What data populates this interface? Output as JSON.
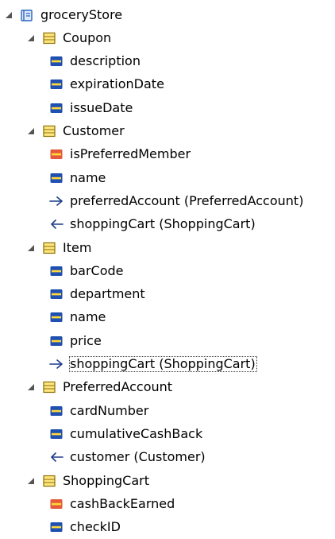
{
  "colors": {
    "attribute_fill": "#1f4fb0",
    "attribute_highlight": "#ffd83a",
    "boolean_fill": "#e45a3a",
    "entity_fill": "#ffe680",
    "entity_border": "#8a6d00",
    "model_icon": "#2b65c4",
    "relationship_stroke": "#1d3d8a"
  },
  "tree": [
    {
      "label": "groceryStore",
      "icon": "model-icon",
      "depth": 0,
      "expanded": true
    },
    {
      "label": "Coupon",
      "icon": "entity-icon",
      "depth": 1,
      "expanded": true
    },
    {
      "label": "description",
      "icon": "attribute-icon",
      "depth": 2
    },
    {
      "label": "expirationDate",
      "icon": "attribute-icon",
      "depth": 2
    },
    {
      "label": "issueDate",
      "icon": "attribute-icon",
      "depth": 2
    },
    {
      "label": "Customer",
      "icon": "entity-icon",
      "depth": 1,
      "expanded": true
    },
    {
      "label": "isPreferredMember",
      "icon": "boolean-attribute-icon",
      "depth": 2
    },
    {
      "label": "name",
      "icon": "attribute-icon",
      "depth": 2
    },
    {
      "label": "preferredAccount (PreferredAccount)",
      "icon": "to-one-relationship-icon",
      "depth": 2
    },
    {
      "label": "shoppingCart (ShoppingCart)",
      "icon": "to-many-relationship-icon",
      "depth": 2
    },
    {
      "label": "Item",
      "icon": "entity-icon",
      "depth": 1,
      "expanded": true
    },
    {
      "label": "barCode",
      "icon": "attribute-icon",
      "depth": 2
    },
    {
      "label": "department",
      "icon": "attribute-icon",
      "depth": 2
    },
    {
      "label": "name",
      "icon": "attribute-icon",
      "depth": 2
    },
    {
      "label": "price",
      "icon": "attribute-icon",
      "depth": 2
    },
    {
      "label": "shoppingCart (ShoppingCart)",
      "icon": "to-one-relationship-icon",
      "depth": 2,
      "selected": true
    },
    {
      "label": "PreferredAccount",
      "icon": "entity-icon",
      "depth": 1,
      "expanded": true
    },
    {
      "label": "cardNumber",
      "icon": "attribute-icon",
      "depth": 2
    },
    {
      "label": "cumulativeCashBack",
      "icon": "attribute-icon",
      "depth": 2
    },
    {
      "label": "customer (Customer)",
      "icon": "to-many-relationship-icon",
      "depth": 2
    },
    {
      "label": "ShoppingCart",
      "icon": "entity-icon",
      "depth": 1,
      "expanded": true
    },
    {
      "label": "cashBackEarned",
      "icon": "boolean-attribute-icon",
      "depth": 2
    },
    {
      "label": "checkID",
      "icon": "attribute-icon",
      "depth": 2
    }
  ]
}
